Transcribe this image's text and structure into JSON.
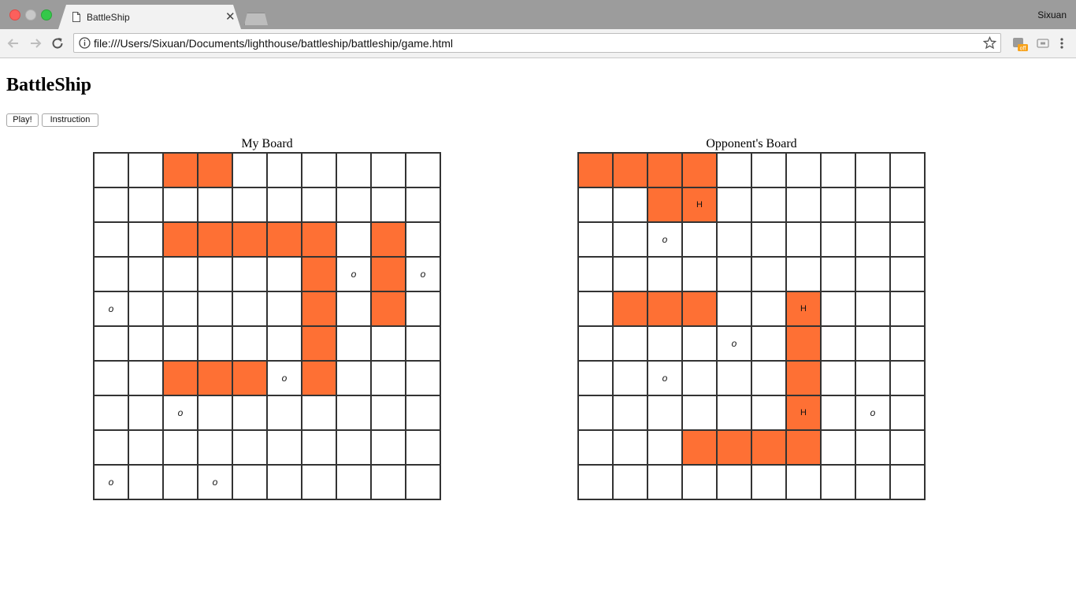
{
  "browser": {
    "tab_title": "BattleShip",
    "user": "Sixuan",
    "url": "file:///Users/Sixuan/Documents/lighthouse/battleship/battleship/game.html"
  },
  "page": {
    "title": "BattleShip",
    "play_label": "Play!",
    "instruction_label": "Instruction"
  },
  "colors": {
    "ship": "#fe7034",
    "grid": "#333333"
  },
  "boards": {
    "mine": {
      "caption": "My Board",
      "rows": [
        "..SS......",
        "..........",
        "..SSSSS.S.",
        "......SoSo",
        "o.....S.S.",
        "......S...",
        "..SSSoS...",
        "..o.......",
        "..........",
        "o..o......"
      ]
    },
    "opponent": {
      "caption": "Opponent's Board",
      "rows": [
        "SSSS......",
        "..SH......",
        "..o.......",
        "..........",
        ".SSS..H...",
        "....o.S...",
        "..o...S...",
        "......H.o.",
        "...SSSS...",
        ".........."
      ]
    },
    "legend": {
      "hit": "H",
      "miss": "o"
    }
  }
}
